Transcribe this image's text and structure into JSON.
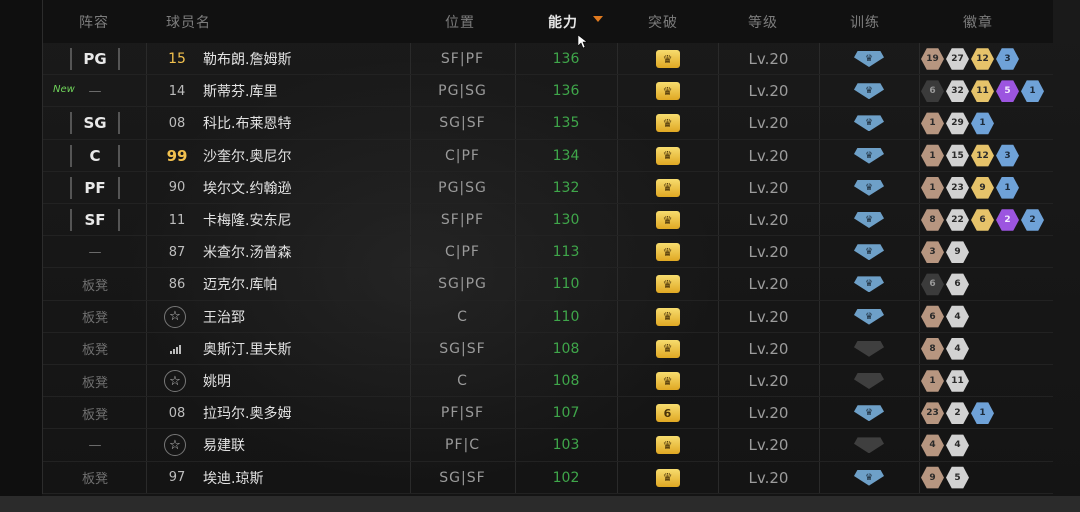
{
  "header": {
    "lineup": "阵容",
    "player_name": "球员名",
    "position": "位置",
    "ability": "能力",
    "breakthrough": "突破",
    "level": "等级",
    "training": "训练",
    "badges": "徽章"
  },
  "accent": {
    "sort_arrow": "#e07a1f",
    "ability_green": "#3fa64a",
    "new_green": "#6fd35a"
  },
  "rows": [
    {
      "lineup": "PG",
      "lineup_style": "box",
      "num": "15",
      "num_style": "gold-plain",
      "name": "勒布朗.詹姆斯",
      "pos": "SF|PF",
      "ability": "136",
      "breakthrough": "",
      "level": "Lv.20",
      "train": "blue",
      "badges": [
        [
          "19",
          "bronze"
        ],
        [
          "27",
          "silver"
        ],
        [
          "12",
          "gold"
        ],
        [
          "3",
          "blue"
        ]
      ]
    },
    {
      "lineup": "—",
      "lineup_style": "text",
      "new": "New",
      "num": "14",
      "num_style": "plain",
      "name": "斯蒂芬.库里",
      "pos": "PG|SG",
      "ability": "136",
      "breakthrough": "",
      "level": "Lv.20",
      "train": "blue",
      "badges": [
        [
          "6",
          "dark"
        ],
        [
          "32",
          "silver"
        ],
        [
          "11",
          "gold"
        ],
        [
          "5",
          "purple"
        ],
        [
          "1",
          "blue"
        ]
      ]
    },
    {
      "lineup": "SG",
      "lineup_style": "box",
      "num": "08",
      "num_style": "plain",
      "name": "科比.布莱恩特",
      "pos": "SG|SF",
      "ability": "135",
      "breakthrough": "",
      "level": "Lv.20",
      "train": "blue",
      "badges": [
        [
          "1",
          "bronze"
        ],
        [
          "29",
          "silver"
        ],
        [
          "1",
          "blue"
        ]
      ]
    },
    {
      "lineup": "C",
      "lineup_style": "box",
      "num": "99",
      "num_style": "gold",
      "name": "沙奎尔.奥尼尔",
      "pos": "C|PF",
      "ability": "134",
      "breakthrough": "",
      "level": "Lv.20",
      "train": "blue",
      "badges": [
        [
          "1",
          "bronze"
        ],
        [
          "15",
          "silver"
        ],
        [
          "12",
          "gold"
        ],
        [
          "3",
          "blue"
        ]
      ]
    },
    {
      "lineup": "PF",
      "lineup_style": "box",
      "num": "90",
      "num_style": "plain",
      "name": "埃尔文.约翰逊",
      "pos": "PG|SG",
      "ability": "132",
      "breakthrough": "",
      "level": "Lv.20",
      "train": "blue",
      "badges": [
        [
          "1",
          "bronze"
        ],
        [
          "23",
          "silver"
        ],
        [
          "9",
          "gold"
        ],
        [
          "1",
          "blue"
        ]
      ]
    },
    {
      "lineup": "SF",
      "lineup_style": "box",
      "num": "11",
      "num_style": "plain",
      "name": "卡梅隆.安东尼",
      "pos": "SF|PF",
      "ability": "130",
      "breakthrough": "",
      "level": "Lv.20",
      "train": "blue",
      "badges": [
        [
          "8",
          "bronze"
        ],
        [
          "22",
          "silver"
        ],
        [
          "6",
          "gold"
        ],
        [
          "2",
          "purple"
        ],
        [
          "2",
          "blue"
        ]
      ]
    },
    {
      "lineup": "—",
      "lineup_style": "text",
      "num": "87",
      "num_style": "plain",
      "name": "米查尔.汤普森",
      "pos": "C|PF",
      "ability": "113",
      "breakthrough": "",
      "level": "Lv.20",
      "train": "blue",
      "badges": [
        [
          "3",
          "bronze"
        ],
        [
          "9",
          "silver"
        ]
      ]
    },
    {
      "lineup": "板凳",
      "lineup_style": "text",
      "num": "86",
      "num_style": "plain",
      "name": "迈克尔.库帕",
      "pos": "SG|PG",
      "ability": "110",
      "breakthrough": "",
      "level": "Lv.20",
      "train": "blue",
      "badges": [
        [
          "6",
          "dark"
        ],
        [
          "6",
          "silver"
        ]
      ]
    },
    {
      "lineup": "板凳",
      "lineup_style": "text",
      "num": "",
      "num_style": "star",
      "name": "王治郅",
      "pos": "C",
      "ability": "110",
      "breakthrough": "",
      "level": "Lv.20",
      "train": "blue",
      "badges": [
        [
          "6",
          "bronze"
        ],
        [
          "4",
          "silver"
        ]
      ]
    },
    {
      "lineup": "板凳",
      "lineup_style": "text",
      "num": "",
      "num_style": "bars",
      "name": "奥斯汀.里夫斯",
      "pos": "SG|SF",
      "ability": "108",
      "breakthrough": "",
      "level": "Lv.20",
      "train": "grey",
      "badges": [
        [
          "8",
          "bronze"
        ],
        [
          "4",
          "silver"
        ]
      ]
    },
    {
      "lineup": "板凳",
      "lineup_style": "text",
      "num": "",
      "num_style": "star",
      "name": "姚明",
      "pos": "C",
      "ability": "108",
      "breakthrough": "",
      "level": "Lv.20",
      "train": "grey",
      "badges": [
        [
          "1",
          "bronze"
        ],
        [
          "11",
          "silver"
        ]
      ]
    },
    {
      "lineup": "板凳",
      "lineup_style": "text",
      "num": "08",
      "num_style": "plain",
      "name": "拉玛尔.奥多姆",
      "pos": "PF|SF",
      "ability": "107",
      "breakthrough": "6",
      "level": "Lv.20",
      "train": "blue",
      "badges": [
        [
          "23",
          "bronze"
        ],
        [
          "2",
          "silver"
        ],
        [
          "1",
          "blue"
        ]
      ]
    },
    {
      "lineup": "—",
      "lineup_style": "text",
      "num": "",
      "num_style": "star",
      "name": "易建联",
      "pos": "PF|C",
      "ability": "103",
      "breakthrough": "",
      "level": "Lv.20",
      "train": "grey",
      "badges": [
        [
          "4",
          "bronze"
        ],
        [
          "4",
          "silver"
        ]
      ]
    },
    {
      "lineup": "板凳",
      "lineup_style": "text",
      "num": "97",
      "num_style": "plain",
      "name": "埃迪.琼斯",
      "pos": "SG|SF",
      "ability": "102",
      "breakthrough": "",
      "level": "Lv.20",
      "train": "blue",
      "badges": [
        [
          "9",
          "bronze"
        ],
        [
          "5",
          "silver"
        ]
      ]
    }
  ]
}
